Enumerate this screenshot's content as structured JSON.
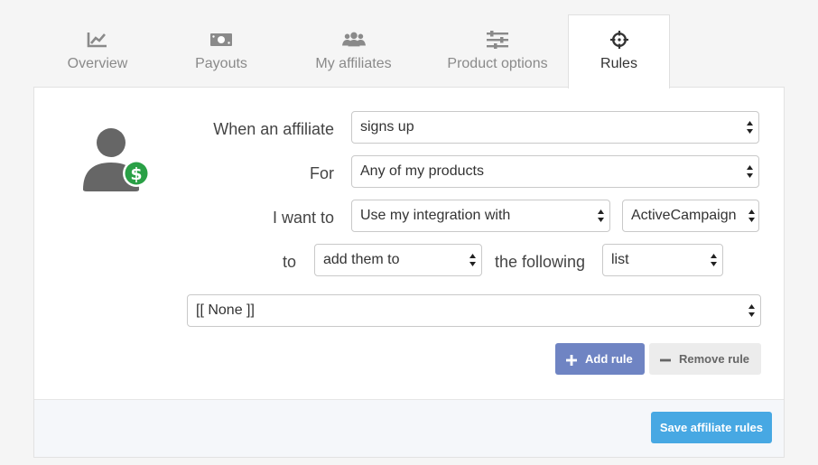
{
  "tabs": [
    {
      "label": "Overview",
      "icon": "chart-icon"
    },
    {
      "label": "Payouts",
      "icon": "money-icon"
    },
    {
      "label": "My affiliates",
      "icon": "users-icon"
    },
    {
      "label": "Product options",
      "icon": "sliders-icon"
    },
    {
      "label": "Rules",
      "icon": "crosshair-icon",
      "active": true
    }
  ],
  "rule": {
    "when_label": "When an affiliate",
    "when_value": "signs up",
    "for_label": "For",
    "for_value": "Any of my products",
    "want_label": "I want to",
    "want_value": "Use my integration with",
    "integration_value": "ActiveCampaign",
    "to_label": "to",
    "action_value": "add them to",
    "following_label": "the following",
    "target_value": "list",
    "list_value": "[[ None ]]"
  },
  "buttons": {
    "add_rule": "Add rule",
    "remove_rule": "Remove rule",
    "save": "Save affiliate rules"
  },
  "colors": {
    "accent_add": "#6f84c3",
    "accent_save": "#47a8e3",
    "dollar_badge": "#2aa046"
  }
}
